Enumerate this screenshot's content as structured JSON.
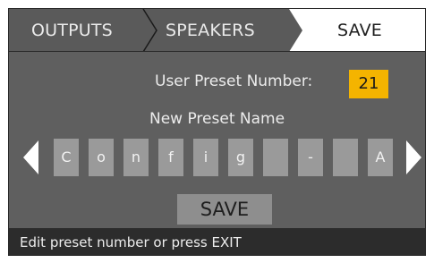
{
  "tabs": [
    {
      "label": "OUTPUTS",
      "active": false
    },
    {
      "label": "SPEAKERS",
      "active": false
    },
    {
      "label": "SAVE",
      "active": true
    }
  ],
  "preset": {
    "number_label": "User Preset Number:",
    "number_value": "21",
    "name_label": "New Preset Name",
    "name_chars": [
      "C",
      "o",
      "n",
      "f",
      "i",
      "g",
      "",
      "-",
      "",
      "A"
    ]
  },
  "save_button": "SAVE",
  "status_text": "Edit preset number or press EXIT",
  "colors": {
    "panel": "#5f5f5f",
    "active_tab": "#ffffff",
    "highlight": "#f4b400",
    "char_box": "#9a9a9a",
    "status_bar": "#2c2c2c"
  },
  "icons": {
    "left": "chevron-left-icon",
    "right": "chevron-right-icon"
  }
}
